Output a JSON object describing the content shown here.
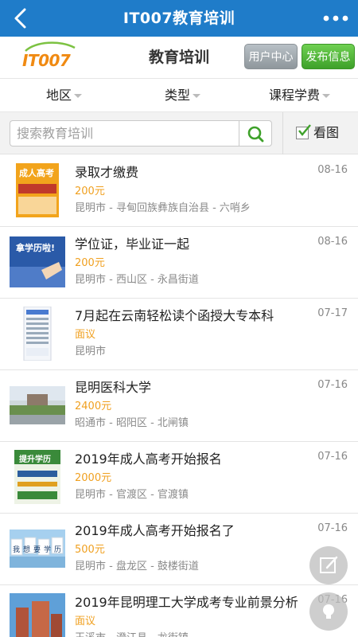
{
  "navbar": {
    "title": "IT007教育培训"
  },
  "header": {
    "logo_text": "IT007",
    "site_name": "教育培训",
    "user_center": "用户中心",
    "post_info": "发布信息"
  },
  "filters": {
    "region": "地区",
    "type": "类型",
    "fee": "课程学费"
  },
  "search": {
    "placeholder": "搜索教育培训",
    "view_toggle_label": "看图",
    "view_toggle_checked": true
  },
  "colors": {
    "navbar": "#1f7cc9",
    "price": "#f0a020",
    "accent_green": "#3ea12a",
    "logo_orange": "#f08a12"
  },
  "items": [
    {
      "title": "录取才缴费",
      "date": "08-16",
      "price": "200元",
      "location": "昆明市 - 寻甸回族彝族自治县 - 六哨乡",
      "thumb_text": "成人高考"
    },
    {
      "title": "学位证，毕业证一起",
      "date": "08-16",
      "price": "200元",
      "location": "昆明市 - 西山区 - 永昌街道",
      "thumb_text": "拿学历啦!"
    },
    {
      "title": "7月起在云南轻松读个函授大专本科",
      "date": "07-17",
      "price": "面议",
      "location": "昆明市",
      "thumb_text": ""
    },
    {
      "title": "昆明医科大学",
      "date": "07-16",
      "price": "2400元",
      "location": "昭通市 - 昭阳区 - 北闸镇",
      "thumb_text": ""
    },
    {
      "title": "2019年成人高考开始报名",
      "date": "07-16",
      "price": "2000元",
      "location": "昆明市 - 官渡区 - 官渡镇",
      "thumb_text": "提升学历"
    },
    {
      "title": "2019年成人高考开始报名了",
      "date": "07-16",
      "price": "500元",
      "location": "昆明市 - 盘龙区 - 鼓楼街道",
      "thumb_text": "我想要学历"
    },
    {
      "title": "2019年昆明理工大学成考专业前景分析",
      "date": "07-16",
      "price": "面议",
      "location": "玉溪市 - 澄江县 - 龙街镇",
      "thumb_text": ""
    }
  ]
}
